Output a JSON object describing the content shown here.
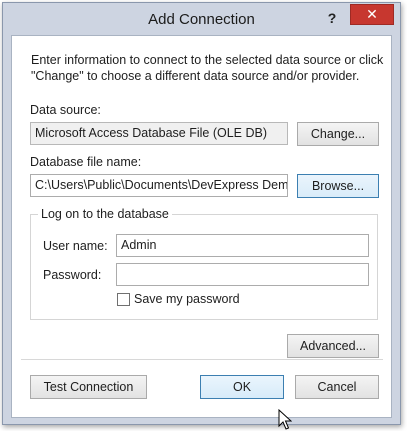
{
  "window": {
    "title": "Add Connection",
    "help_symbol": "?",
    "close_symbol": "✕"
  },
  "intro": {
    "line1": "Enter information to connect to the selected data source or click",
    "line2": "\"Change\" to choose a different data source and/or provider."
  },
  "data_source": {
    "label": "Data source:",
    "value": "Microsoft Access Database File (OLE DB)",
    "change_button": "Change..."
  },
  "database_file": {
    "label": "Database file name:",
    "value": "C:\\Users\\Public\\Documents\\DevExpress Demos",
    "browse_button": "Browse..."
  },
  "logon": {
    "group_title": "Log on to the database",
    "username_label": "User name:",
    "username_value": "Admin",
    "password_label": "Password:",
    "password_value": "",
    "save_password_label": "Save my password",
    "save_password_checked": false
  },
  "buttons": {
    "advanced": "Advanced...",
    "test_connection": "Test Connection",
    "ok": "OK",
    "cancel": "Cancel"
  },
  "colors": {
    "frame": "#cdd4e1",
    "close_button": "#c7372f",
    "focus_border": "#3c7fb1"
  }
}
